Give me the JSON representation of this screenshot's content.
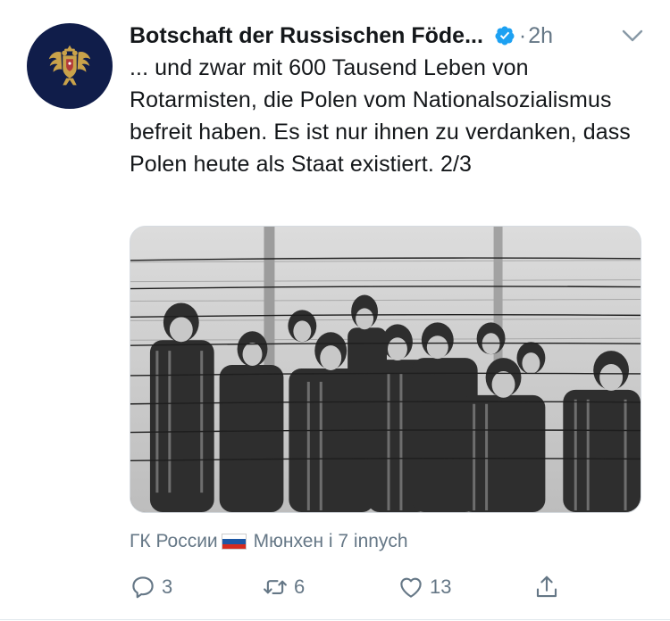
{
  "tweet": {
    "author": {
      "name": "Botschaft der Russischen Föde...",
      "verified": true,
      "avatar_icon": "double-headed-eagle-emblem",
      "avatar_bg": "#101d4a",
      "emblem_color": "#c9a24a"
    },
    "separator": "·",
    "timestamp": "2h",
    "text": "... und zwar mit 600 Tausend Leben von Rotarmisten, die Polen vom Nationalsozialismus befreit haben. Es ist nur ihnen zu verdanken, dass Polen heute als Staat existiert. 2/3",
    "media": {
      "kind": "black-and-white photograph",
      "icon": "photo-children-behind-barbed-wire"
    },
    "social_context": {
      "prefix": "ГК России",
      "flag_icon": "russia-flag",
      "suffix": "Мюнхен i 7 innych"
    },
    "actions": {
      "reply": {
        "icon": "reply-icon",
        "count": "3"
      },
      "retweet": {
        "icon": "retweet-icon",
        "count": "6"
      },
      "like": {
        "icon": "heart-icon",
        "count": "13"
      },
      "share": {
        "icon": "share-icon"
      }
    },
    "colors": {
      "text": "#14171a",
      "secondary": "#657786",
      "verified": "#1da1f2",
      "border": "#e1e8ed"
    }
  }
}
